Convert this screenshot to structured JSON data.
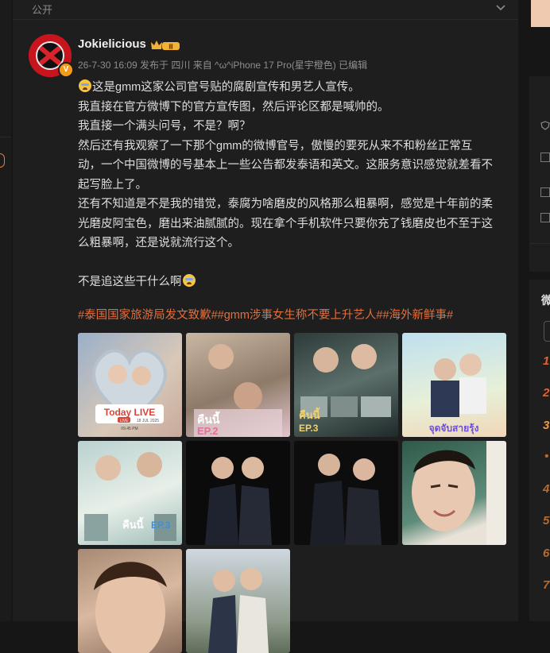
{
  "visibility": {
    "label": "公开"
  },
  "post": {
    "author": "Jokielicious",
    "badge_text": "Ⅲ",
    "meta": "26-7-30 16:09 发布于 四川 来自 ^ω^iPhone 17 Pro(星宇橙色) 已编辑",
    "lines": [
      "这是gmm这家公司官号贴的腐剧宣传和男艺人宣传。",
      "我直接在官方微博下的官方宣传图，然后评论区都是喊帅的。",
      "我直接一个满头问号，不是？啊？",
      "然后还有我观察了一下那个gmm的微博官号，傲慢的要死从来不和粉丝正常互",
      "动，一个中国微博的号基本上一些公告都发泰语和英文。这服务意识感觉就差看不",
      "起写脸上了。",
      "还有不知道是不是我的错觉，泰腐为啥磨皮的风格那么粗暴啊，感觉是十年前的柔",
      "光磨皮阿宝色，磨出来油腻腻的。现在拿个手机软件只要你充了钱磨皮也不至于这",
      "么粗暴啊，还是说就流行这个。",
      "",
      "不是追这些干什么啊"
    ],
    "hashtags": "#泰国国家旅游局发文致歉##gmm涉事女生称不要上升艺人##海外新鲜事#",
    "photos": [
      {
        "texts": [
          "Today LIVE",
          "LIVE",
          "18 JUL 2025",
          "09.45 PM"
        ]
      },
      {
        "texts": [
          "คืนนี้",
          "EP.2"
        ]
      },
      {
        "texts": [
          "คืนนี้",
          "EP.3"
        ]
      },
      {
        "texts": [
          "จุดจับสายรุ้ง"
        ]
      },
      {
        "texts": [
          "คืนนี้",
          "EP.3"
        ]
      },
      {
        "texts": []
      },
      {
        "texts": []
      },
      {
        "texts": []
      },
      {
        "texts": []
      },
      {
        "texts": []
      }
    ]
  },
  "sidebar": {
    "title": "微",
    "ranks": [
      "1",
      "2",
      "3",
      "•",
      "4",
      "5",
      "6",
      "7"
    ]
  },
  "colors": {
    "background": "#161616",
    "card": "#1e1e1e",
    "text": "#dedede",
    "meta": "#8e8e8e",
    "accent": "#e36f3c"
  }
}
